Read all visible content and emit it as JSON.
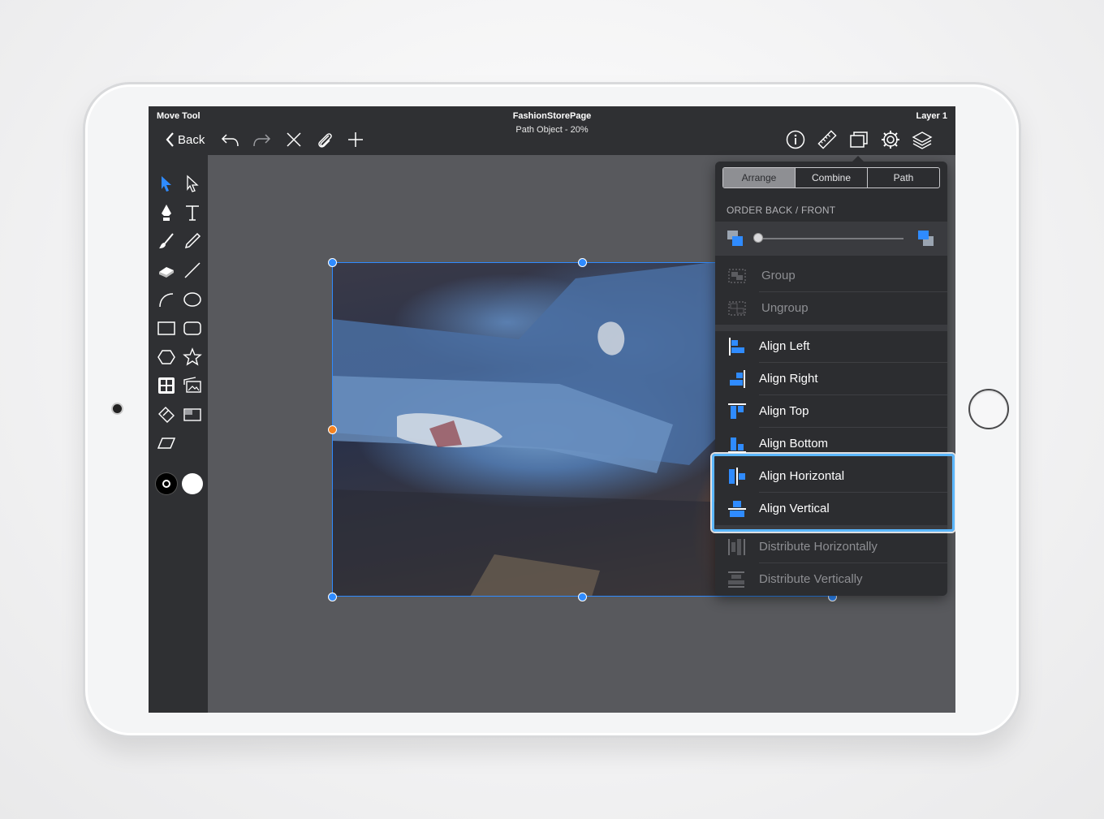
{
  "topbar": {
    "tool_name": "Move Tool",
    "document_title": "FashionStorePage",
    "document_subtitle": "Path Object - 20%",
    "layer_name": "Layer 1",
    "back_label": "Back",
    "icons": [
      "undo-icon",
      "redo-icon",
      "close-icon",
      "attach-icon",
      "add-icon",
      "info-icon",
      "ruler-icon",
      "arrange-icon",
      "settings-icon",
      "layers-icon"
    ]
  },
  "toolbox": {
    "tools": [
      "selection-arrow",
      "direct-selection-arrow",
      "pen",
      "text",
      "brush",
      "pencil",
      "eraser",
      "line",
      "arc",
      "ellipse",
      "rectangle",
      "rounded-rectangle",
      "hexagon",
      "star",
      "grid",
      "image",
      "transform",
      "frame",
      "skew"
    ],
    "stroke_color": "#000000",
    "fill_color": "#ffffff"
  },
  "popover": {
    "tabs": [
      "Arrange",
      "Combine",
      "Path"
    ],
    "active_tab": "Arrange",
    "order_label": "ORDER BACK / FRONT",
    "order_value": 0,
    "items": {
      "group": "Group",
      "ungroup": "Ungroup",
      "align_left": "Align Left",
      "align_right": "Align Right",
      "align_top": "Align Top",
      "align_bottom": "Align Bottom",
      "align_horizontal": "Align Horizontal",
      "align_vertical": "Align Vertical",
      "distribute_horizontally": "Distribute Horizontally",
      "distribute_vertically": "Distribute Vertically"
    }
  },
  "colors": {
    "accent": "#2f8bff",
    "highlight": "#5bb7ff",
    "toolbar_bg": "#2f3033",
    "canvas_bg": "#58595d"
  }
}
